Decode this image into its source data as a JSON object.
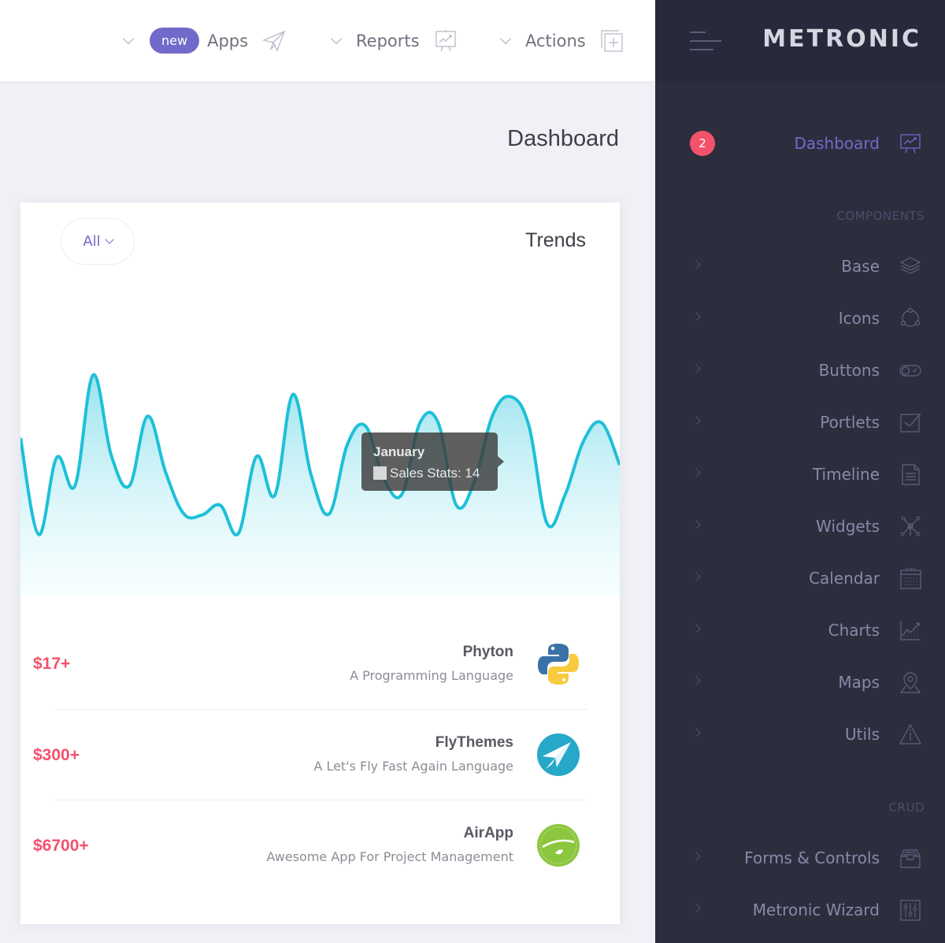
{
  "topnav": {
    "items": [
      {
        "badge": "new",
        "label": "Apps",
        "icon": "paper-plane-icon"
      },
      {
        "label": "Reports",
        "icon": "presentation-chart-icon"
      },
      {
        "label": "Actions",
        "icon": "add-copy-icon"
      }
    ]
  },
  "sidebar": {
    "brand": "METRONIC",
    "dashboard": {
      "label": "Dashboard",
      "badge": "2",
      "icon": "presentation-chart-icon"
    },
    "sections": [
      {
        "title": "COMPONENTS"
      },
      {
        "title": "CRUD"
      }
    ],
    "items": [
      {
        "label": "Base",
        "icon": "layers-icon"
      },
      {
        "label": "Icons",
        "icon": "network-circle-icon"
      },
      {
        "label": "Buttons",
        "icon": "toggle-icon"
      },
      {
        "label": "Portlets",
        "icon": "checkbox-icon"
      },
      {
        "label": "Timeline",
        "icon": "document-icon"
      },
      {
        "label": "Widgets",
        "icon": "nodes-icon"
      },
      {
        "label": "Calendar",
        "icon": "calendar-icon"
      },
      {
        "label": "Charts",
        "icon": "line-chart-icon"
      },
      {
        "label": "Maps",
        "icon": "map-pin-icon"
      },
      {
        "label": "Utils",
        "icon": "warning-icon"
      },
      {
        "label": "Forms & Controls",
        "icon": "inbox-icon"
      },
      {
        "label": "Metronic Wizard",
        "icon": "equalizer-icon"
      }
    ]
  },
  "page": {
    "title": "Dashboard"
  },
  "card": {
    "filter_label": "All",
    "title": "Trends",
    "tooltip": {
      "title": "January",
      "text": "Sales Stats: 14"
    },
    "items": [
      {
        "price": "$17+",
        "name": "Phyton",
        "desc": "A Programming Language",
        "logo": "python-logo"
      },
      {
        "price": "$300+",
        "name": "FlyThemes",
        "desc": "A Let's Fly Fast Again Language",
        "logo": "flythemes-logo"
      },
      {
        "price": "$6700+",
        "name": "AirApp",
        "desc": "Awesome App For Project Management",
        "logo": "hellofresh-logo"
      }
    ]
  },
  "colors": {
    "accent": "#716aca",
    "danger": "#f4516c",
    "line": "#1ec0d8",
    "sidebar_bg": "#2c2e3e"
  },
  "chart_data": {
    "type": "area",
    "title": "Trends",
    "series": [
      {
        "name": "Sales Stats",
        "values": [
          14.6,
          5.7,
          12.8,
          10.2,
          20.4,
          13.0,
          10.2,
          16.6,
          11.4,
          7.6,
          7.5,
          8.4,
          5.8,
          12.9,
          9.3,
          18.6,
          11.2,
          7.6,
          14.0,
          15.7,
          10.9,
          9.4,
          16.0,
          16.0,
          8.4,
          10.6,
          16.7,
          18.4,
          15.7,
          6.7,
          9.4,
          14.3,
          16.0,
          12.1
        ]
      }
    ],
    "ylim": [
      0,
      22
    ],
    "grid": false,
    "tooltip_category": "January",
    "tooltip_value": 14
  }
}
